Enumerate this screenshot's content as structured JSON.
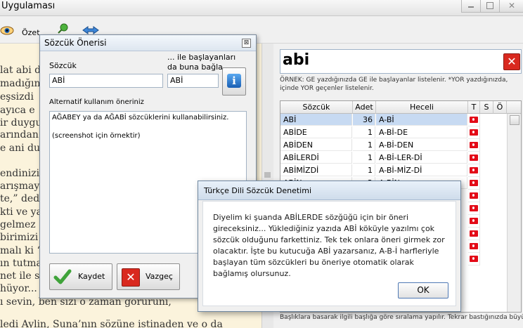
{
  "window": {
    "title": "Uygulaması"
  },
  "toolbar": {
    "ozet_label": "Özet"
  },
  "document": {
    "lines": [
      "lat abi d",
      "madığın",
      "eşsizdi",
      "ayıca e",
      "ir duygu",
      "arından",
      "e ani du",
      "endinizi",
      "arışmay",
      "te,” ded",
      "kti ve ya",
      " gelmez",
      "birimizi",
      "malı ki “",
      "ın tutma",
      "net ile s",
      "hüyor...",
      "ı sevin, ben sizi o zaman göruruni,",
      "",
      "ledi Aylin, Suna’nın sözüne istinaden ve o da"
    ]
  },
  "right": {
    "search_value": "abi",
    "hint": "ÖRNEK: GE yazdığınızda GE ile başlayanlar listelenir. *YOR yazdığınızda, içinde YOR geçenler listelenir.",
    "columns": [
      "Sözcük",
      "Adet",
      "Heceli",
      "T",
      "S",
      "Ö"
    ],
    "rows": [
      {
        "word": "ABİ",
        "count": "36",
        "syllable": "A-Bİ",
        "selected": true
      },
      {
        "word": "ABİDE",
        "count": "1",
        "syllable": "A-Bİ-DE"
      },
      {
        "word": "ABİDEN",
        "count": "1",
        "syllable": "A-Bİ-DEN"
      },
      {
        "word": "ABİLERDİ",
        "count": "1",
        "syllable": "A-Bİ-LER-Dİ"
      },
      {
        "word": "ABİMİZDİ",
        "count": "1",
        "syllable": "A-Bİ-MİZ-Dİ"
      },
      {
        "word": "ABİN",
        "count": "2",
        "syllable": "A-BİN"
      }
    ],
    "footer": "Başlıklara basarak ilgili başlığa göre sıralama yapılır. Tekrar bastığınızda büyükten"
  },
  "dialog": {
    "title": "Sözcük Önerisi",
    "close_glyph": "⊠",
    "word_label": "Sözcük",
    "word_value": "ABİ",
    "prefix_label": "... ile başlayanları da buna bağla",
    "prefix_value": "ABİ",
    "alt_label": "Alternatif kullanım öneriniz",
    "alt_line1": "AĞABEY ya da AĞABİ sözcüklerini kullanabilirsiniz.",
    "alt_line2": "(screenshot için örnektir)",
    "save_label": "Kaydet",
    "cancel_label": "Vazgeç"
  },
  "message": {
    "title": "Türkçe Dili Sözcük Denetimi",
    "text": "Diyelim ki şuanda ABİLERDE sözğüğü için bir öneri gireceksiniz... Yüklediğiniz yazıda ABİ köküyle yazılmı çok sözcük olduğunu farkettiniz. Tek tek onlara öneri girmek zor olacaktır. İşte bu kutucuğa ABİ yazarsanız, A-B-İ harfleriyle başlayan tüm sözcükleri bu öneriye otomatik olarak bağlamış olursunuz.",
    "ok_label": "OK"
  },
  "colors": {
    "selection": "#c7daf2",
    "flag_red": "#e30a17",
    "doc_bg": "#fbf3dc",
    "delete_red": "#d9291f"
  }
}
